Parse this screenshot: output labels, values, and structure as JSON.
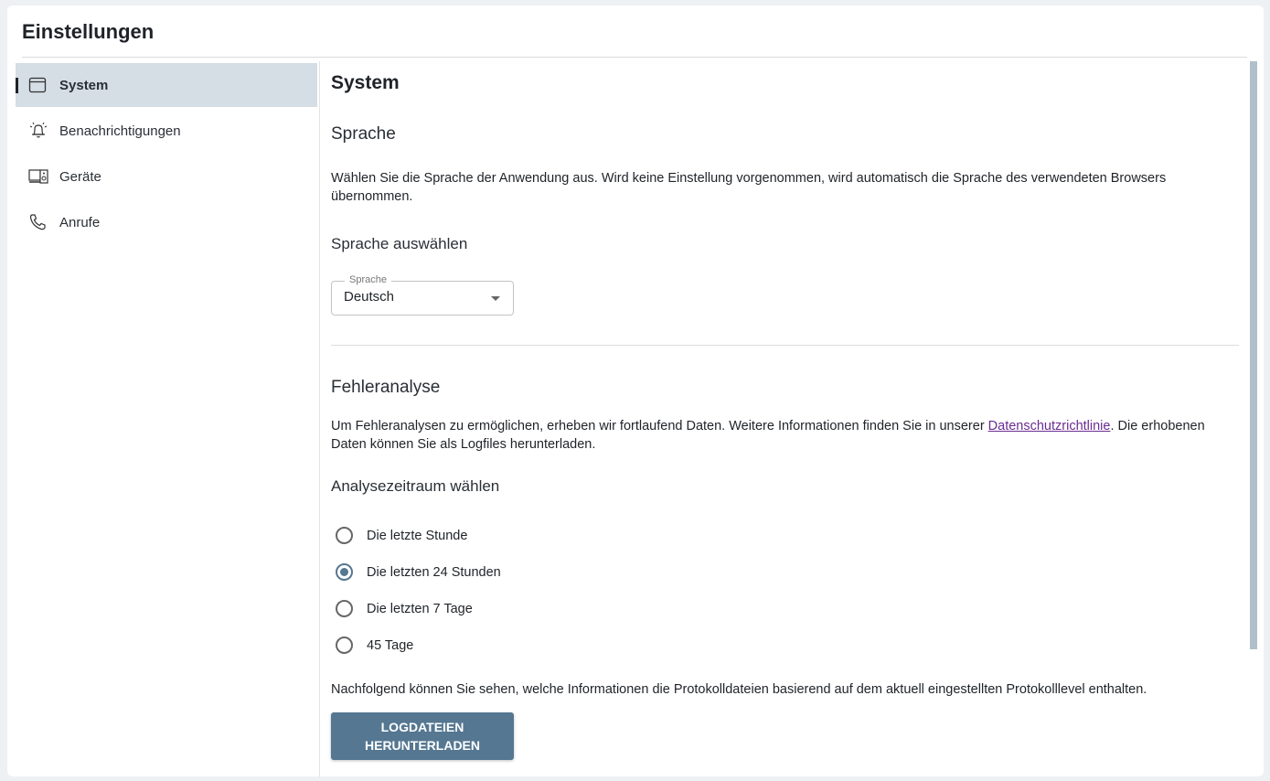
{
  "header": {
    "title": "Einstellungen"
  },
  "sidebar": {
    "items": [
      {
        "label": "System",
        "icon": "window-icon",
        "active": true
      },
      {
        "label": "Benachrichtigungen",
        "icon": "bell-icon"
      },
      {
        "label": "Geräte",
        "icon": "devices-icon"
      },
      {
        "label": "Anrufe",
        "icon": "phone-icon"
      }
    ]
  },
  "main": {
    "title": "System",
    "language": {
      "heading": "Sprache",
      "description": "Wählen Sie die Sprache der Anwendung aus. Wird keine Einstellung vorgenommen, wird automatisch die Sprache des verwendeten Browsers übernommen.",
      "subheading": "Sprache auswählen",
      "select_label": "Sprache",
      "select_value": "Deutsch"
    },
    "analysis": {
      "heading": "Fehleranalyse",
      "description_before": "Um Fehleranalysen zu ermöglichen, erheben wir fortlaufend Daten. Weitere Informationen finden Sie in unserer ",
      "link": "Datenschutzrichtlinie",
      "description_after": ". Die erhobenen Daten können Sie als Logfiles herunterladen.",
      "subheading": "Analysezeitraum wählen",
      "options": [
        "Die letzte Stunde",
        "Die letzten 24 Stunden",
        "Die letzten 7 Tage",
        "45 Tage"
      ],
      "selected": "Die letzten 24 Stunden",
      "info": "Nachfolgend können Sie sehen, welche Informationen die Protokolldateien basierend auf dem aktuell eingestellten Protokolllevel enthalten.",
      "download_button": "Logdateien herunterladen"
    }
  },
  "colors": {
    "accent": "#557791",
    "active_bg": "#d5dde5",
    "link": "#6a2c91"
  }
}
